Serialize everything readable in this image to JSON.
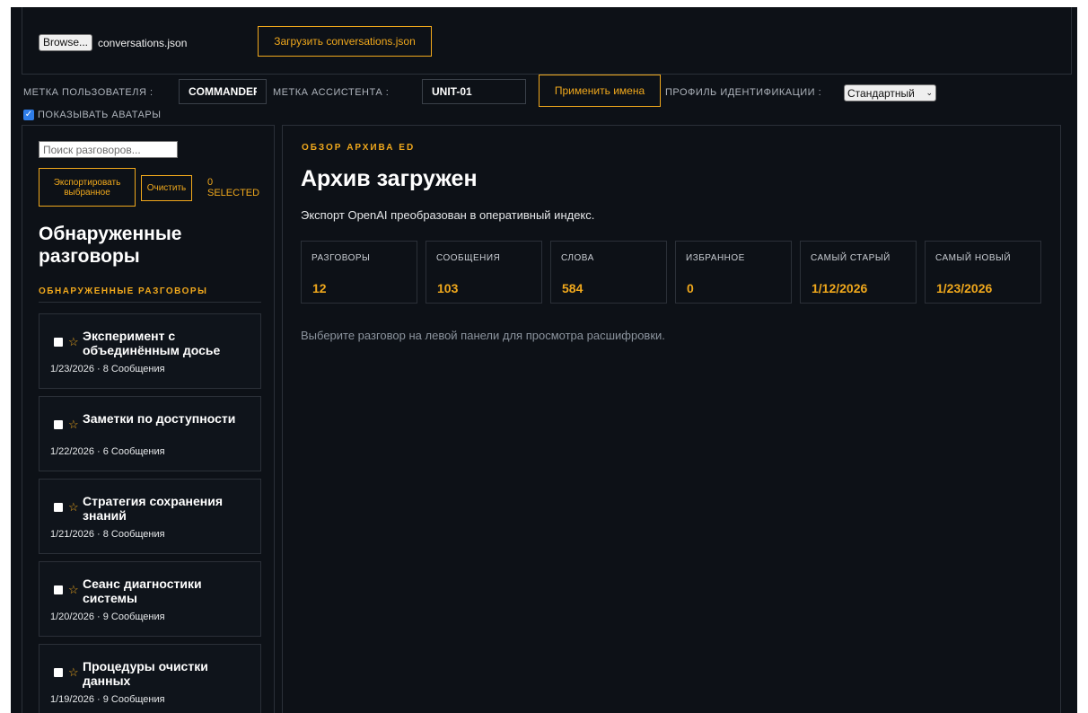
{
  "file": {
    "browse_label": "Browse...",
    "file_name": "conversations.json",
    "load_label": "Загрузить conversations.json"
  },
  "names": {
    "user_label": "МЕТКА ПОЛЬЗОВАТЕЛЯ :",
    "user_value": "COMMANDER",
    "assistant_label": "МЕТКА АССИСТЕНТА :",
    "assistant_value": "UNIT-01",
    "apply_label": "Применить имена",
    "profile_label": "ПРОФИЛЬ ИДЕНТИФИКАЦИИ :",
    "profile_value": "Стандартный",
    "show_avatars_label": "ПОКАЗЫВАТЬ АВАТАРЫ",
    "show_avatars_checked": true
  },
  "sidebar": {
    "search_placeholder": "Поиск разговоров...",
    "export_label": "Экспортировать выбранное",
    "clear_label": "Очистить",
    "selected_count": "0",
    "selected_label": "SELECTED",
    "title": "Обнаруженные разговоры",
    "subtitle": "ОБНАРУЖЕННЫЕ РАЗГОВОРЫ",
    "conversations": [
      {
        "title": "Эксперимент с объединённым досье",
        "meta": "1/23/2026 · 8 Сообщения"
      },
      {
        "title": "Заметки по доступности",
        "meta": "1/22/2026 · 6 Сообщения"
      },
      {
        "title": "Стратегия сохранения знаний",
        "meta": "1/21/2026 · 8 Сообщения"
      },
      {
        "title": "Сеанс диагностики системы",
        "meta": "1/20/2026 · 9 Сообщения"
      },
      {
        "title": "Процедуры очистки данных",
        "meta": "1/19/2026 · 9 Сообщения"
      }
    ]
  },
  "main": {
    "eyebrow": "ОБЗОР АРХИВА ED",
    "title": "Архив загружен",
    "description": "Экспорт OpenAI преобразован в оперативный индекс.",
    "stats": [
      {
        "label": "РАЗГОВОРЫ",
        "value": "12"
      },
      {
        "label": "СООБЩЕНИЯ",
        "value": "103"
      },
      {
        "label": "СЛОВА",
        "value": "584"
      },
      {
        "label": "ИЗБРАННОЕ",
        "value": "0"
      },
      {
        "label": "САМЫЙ СТАРЫЙ",
        "value": "1/12/2026"
      },
      {
        "label": "САМЫЙ НОВЫЙ",
        "value": "1/23/2026"
      }
    ],
    "hint": "Выберите разговор на левой панели для просмотра расшифровки."
  },
  "colors": {
    "background": "#0d1117",
    "accent": "#f0a81c",
    "border": "#2b3038",
    "checkbox": "#2f7de8"
  },
  "icons": {
    "favorite": "star-outline-icon",
    "select_arrow": "chevron-down-icon",
    "checkbox": "checkmark-icon"
  }
}
